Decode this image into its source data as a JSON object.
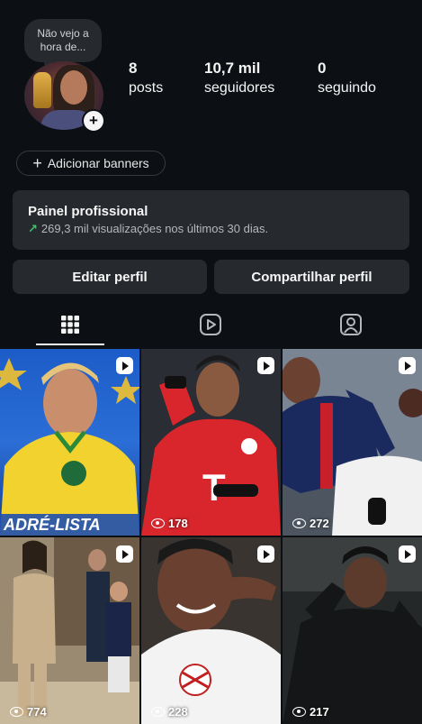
{
  "note": {
    "line1": "Não vejo a",
    "line2": "hora de..."
  },
  "stats": [
    {
      "num": "8",
      "label": "posts"
    },
    {
      "num": "10,7 mil",
      "label": "seguidores"
    },
    {
      "num": "0",
      "label": "seguindo"
    }
  ],
  "banners_label": "Adicionar banners",
  "panel": {
    "title": "Painel profissional",
    "subtitle": "269,3 mil visualizações nos últimos 30 dias."
  },
  "buttons": {
    "edit": "Editar perfil",
    "share": "Compartilhar perfil"
  },
  "tabs": [
    {
      "icon": "grid-icon"
    },
    {
      "icon": "reels-icon"
    },
    {
      "icon": "tagged-icon"
    }
  ],
  "posts": [
    {
      "overlay": "ADRÉ-LISTA",
      "views": ""
    },
    {
      "views": "178"
    },
    {
      "views": "272"
    },
    {
      "views": "774"
    },
    {
      "views": "228"
    },
    {
      "views": "217"
    }
  ],
  "colors": {
    "background": "#0c1014",
    "surface": "#262a2e",
    "accent_green": "#3ec46d"
  }
}
